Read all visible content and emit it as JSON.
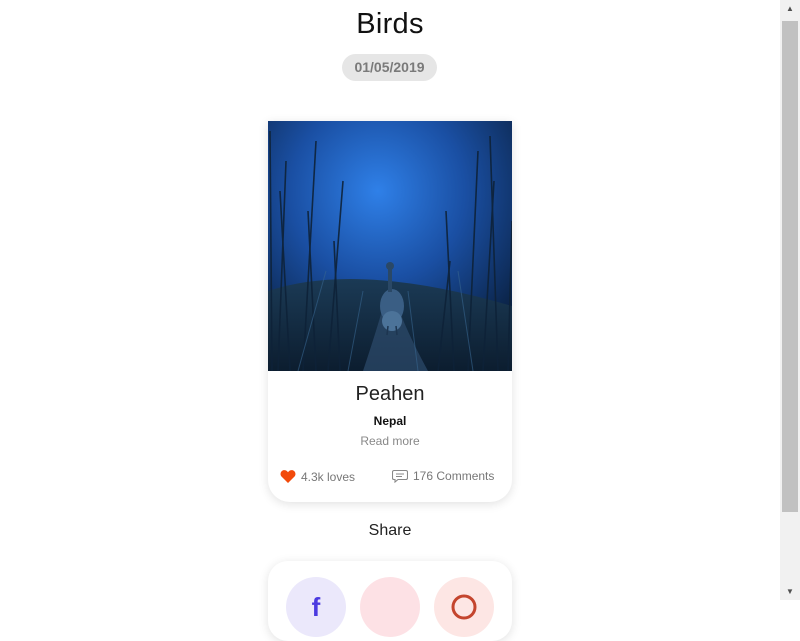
{
  "page": {
    "title": "Birds",
    "date": "01/05/2019"
  },
  "card": {
    "image_alt": "Peahen in a blue forest",
    "title": "Peahen",
    "location": "Nepal",
    "read_more": "Read more",
    "loves": "4.3k loves",
    "comments": "176 Comments",
    "heart_color": "#f24a0a"
  },
  "share": {
    "label": "Share",
    "buttons": [
      {
        "icon": "facebook-icon",
        "glyph": "f"
      },
      {
        "icon": "twitter-icon",
        "glyph": ""
      },
      {
        "icon": "pinterest-icon",
        "glyph": ""
      }
    ]
  },
  "scrollbar": {
    "up_glyph": "▲",
    "down_glyph": "▼"
  }
}
